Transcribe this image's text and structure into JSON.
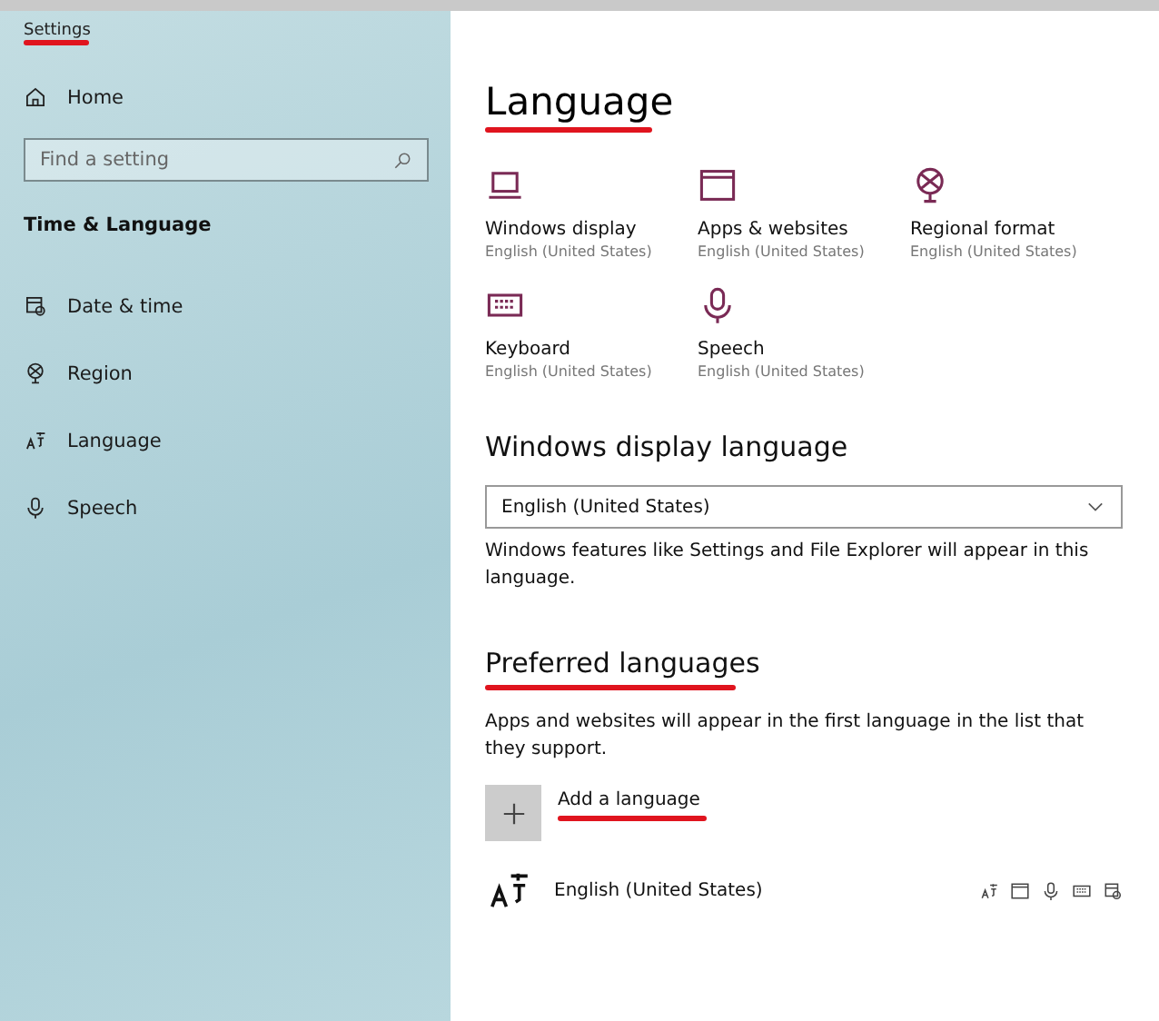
{
  "window": {
    "title": "Settings"
  },
  "sidebar": {
    "home": "Home",
    "search": {
      "placeholder": "Find a setting"
    },
    "section": "Time & Language",
    "items": [
      {
        "label": "Date & time"
      },
      {
        "label": "Region"
      },
      {
        "label": "Language"
      },
      {
        "label": "Speech"
      }
    ]
  },
  "page": {
    "title": "Language",
    "tiles": [
      {
        "label": "Windows display",
        "value": "English (United States)"
      },
      {
        "label": "Apps & websites",
        "value": "English (United States)"
      },
      {
        "label": "Regional format",
        "value": "English (United States)"
      },
      {
        "label": "Keyboard",
        "value": "English (United States)"
      },
      {
        "label": "Speech",
        "value": "English (United States)"
      }
    ],
    "display_language": {
      "heading": "Windows display language",
      "value": "English (United States)",
      "note": "Windows features like Settings and File Explorer will appear in this language."
    },
    "preferred": {
      "heading": "Preferred languages",
      "note": "Apps and websites will appear in the first language in the list that they support.",
      "add": "Add a language",
      "languages": [
        {
          "name": "English (United States)"
        }
      ]
    }
  }
}
